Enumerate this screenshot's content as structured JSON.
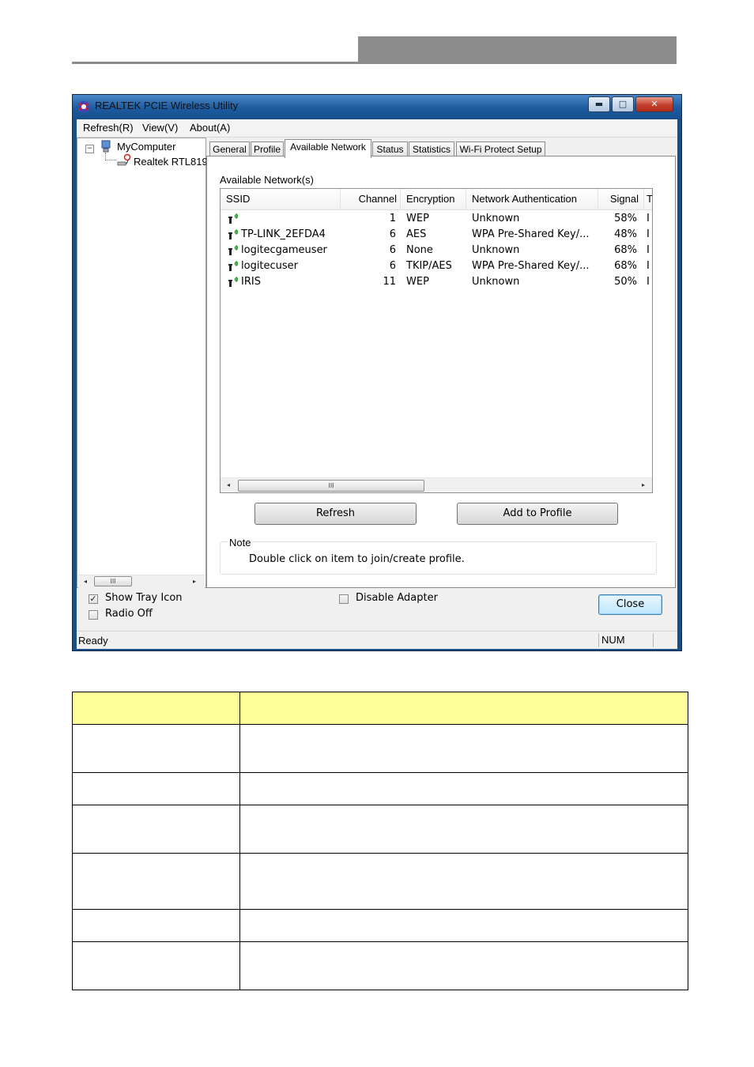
{
  "window": {
    "title": "REALTEK PCIE Wireless Utility",
    "caption_buttons": {
      "minimize": "▬",
      "maximize": "□",
      "close": "✕"
    }
  },
  "menu": [
    "Refresh(R)",
    "View(V)",
    "About(A)"
  ],
  "tree": {
    "expander": "−",
    "root": "MyComputer",
    "child": "Realtek RTL819",
    "scroll_left": "◂",
    "scroll_right": "▸",
    "scroll_grip": "III"
  },
  "tabs": [
    "General",
    "Profile",
    "Available Network",
    "Status",
    "Statistics",
    "Wi-Fi Protect Setup"
  ],
  "active_tab": "Available Network",
  "available": {
    "label": "Available Network(s)",
    "columns": [
      "SSID",
      "Channel",
      "Encryption",
      "Network Authentication",
      "Signal",
      "T"
    ],
    "rows": [
      {
        "ssid": "",
        "channel": "1",
        "encryption": "WEP",
        "auth": "Unknown",
        "signal": "58%",
        "type": "I"
      },
      {
        "ssid": "TP-LINK_2EFDA4",
        "channel": "6",
        "encryption": "AES",
        "auth": "WPA Pre-Shared Key/...",
        "signal": "48%",
        "type": "I"
      },
      {
        "ssid": "logitecgameuser",
        "channel": "6",
        "encryption": "None",
        "auth": "Unknown",
        "signal": "68%",
        "type": "I"
      },
      {
        "ssid": "logitecuser",
        "channel": "6",
        "encryption": "TKIP/AES",
        "auth": "WPA Pre-Shared Key/...",
        "signal": "68%",
        "type": "I"
      },
      {
        "ssid": "IRIS",
        "channel": "11",
        "encryption": "WEP",
        "auth": "Unknown",
        "signal": "50%",
        "type": "I"
      }
    ],
    "scroll_left": "◂",
    "scroll_right": "▸",
    "scroll_grip": "III",
    "refresh_button": "Refresh",
    "add_profile_button": "Add to Profile",
    "note_title": "Note",
    "note_text": "Double click on item to join/create profile."
  },
  "bottom": {
    "show_tray_icon": "Show Tray Icon",
    "show_tray_checked": "✓",
    "radio_off": "Radio Off",
    "disable_adapter": "Disable Adapter",
    "close_button": "Close"
  },
  "status": {
    "left": "Ready",
    "right": "NUM"
  },
  "colors": {
    "table_header": "#ffff99",
    "header_bar": "#8c8c8c",
    "signal_icon": "#2aa52a"
  }
}
